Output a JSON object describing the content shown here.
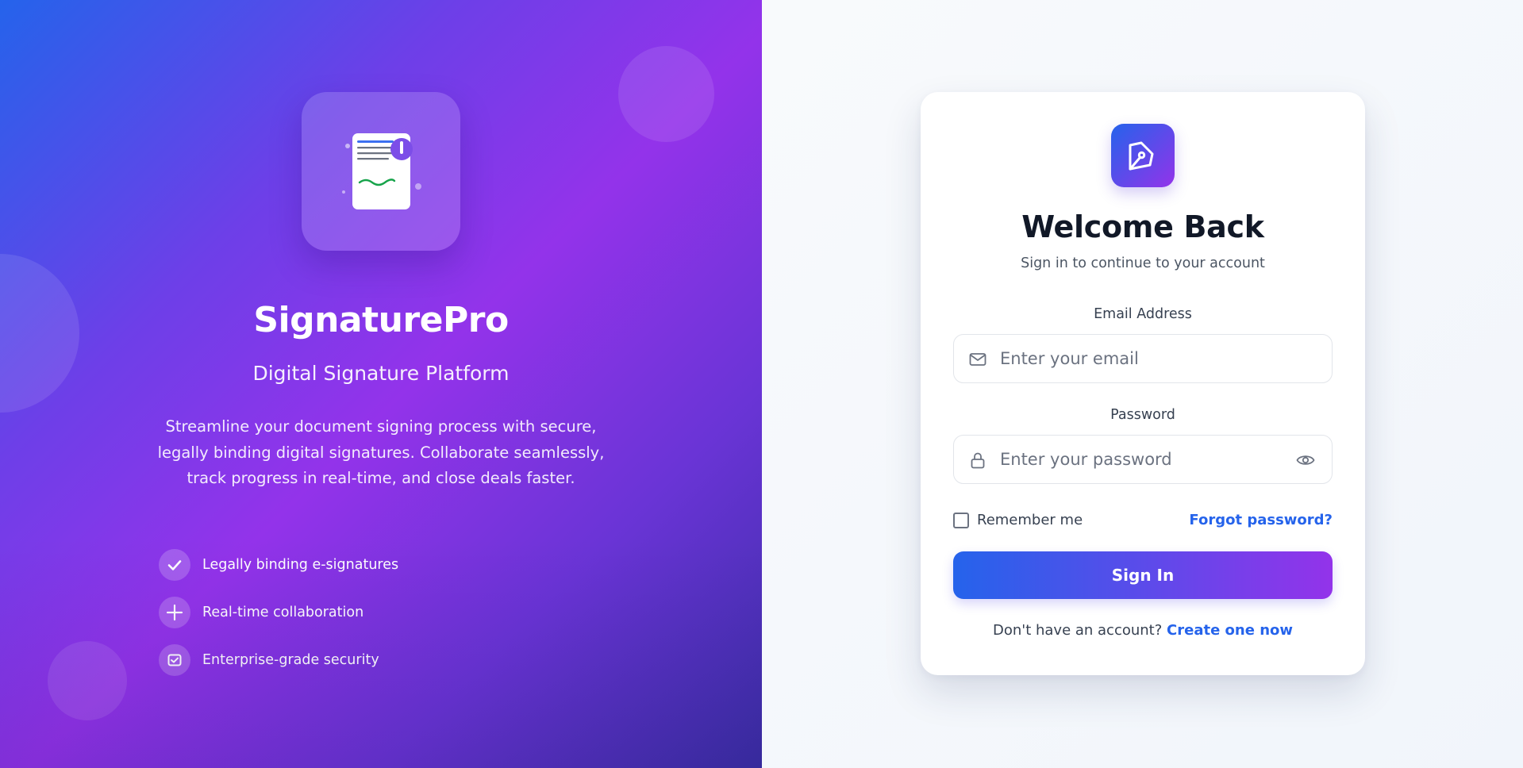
{
  "brand": {
    "name": "SignaturePro",
    "tagline": "Digital Signature Platform",
    "description": "Streamline your document signing process with secure, legally binding digital signatures. Collaborate seamlessly, track progress in real-time, and close deals faster.",
    "logo_icon": "signed-document-icon"
  },
  "features": [
    {
      "icon": "check-icon",
      "label": "Legally binding e-signatures"
    },
    {
      "icon": "plus-icon",
      "label": "Real-time collaboration"
    },
    {
      "icon": "shield-check-icon",
      "label": "Enterprise-grade security"
    }
  ],
  "login": {
    "badge_icon": "pen-nib-icon",
    "title": "Welcome Back",
    "subtitle": "Sign in to continue to your account",
    "email": {
      "label": "Email Address",
      "placeholder": "Enter your email",
      "value": "",
      "icon": "mail-icon"
    },
    "password": {
      "label": "Password",
      "placeholder": "Enter your password",
      "value": "",
      "icon": "lock-icon",
      "toggle_icon": "eye-icon"
    },
    "remember_label": "Remember me",
    "remember_checked": false,
    "forgot_label": "Forgot password?",
    "submit_label": "Sign In",
    "signup_prompt": "Don't have an account?",
    "signup_link": "Create one now"
  },
  "colors": {
    "accent": "#2563eb",
    "accent_purple": "#9333ea",
    "heading": "#111827",
    "body_text": "#4b5563"
  }
}
